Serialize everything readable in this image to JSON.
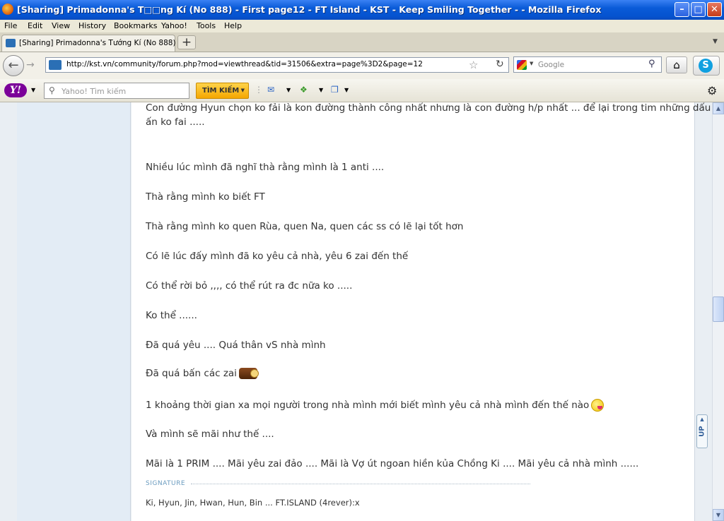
{
  "window": {
    "title": "[Sharing] Primadonna's T□□ng Kí (No 888) - First page12 - FT Island - KST - Keep Smiling Together - - Mozilla Firefox",
    "minimize": "–",
    "maximize": "□",
    "close": "✕"
  },
  "menu": [
    "File",
    "Edit",
    "View",
    "History",
    "Bookmarks",
    "Yahoo!",
    "Tools",
    "Help"
  ],
  "tabs": [
    {
      "label": "[Sharing] Primadonna's Tướng Kí (No 888) - ...",
      "icon": "kst-site-icon"
    }
  ],
  "newtab_label": "+",
  "navigation": {
    "url": "http://kst.vn/community/forum.php?mod=viewthread&tid=31506&extra=page%3D2&page=12",
    "search_placeholder": "Google"
  },
  "yahoo_toolbar": {
    "search_placeholder": "Yahoo! Tìm kiếm",
    "search_button": "TÌM KIẾM",
    "logo": "Y!"
  },
  "post": {
    "lines": [
      "Con đường Hyun chọn ko fải là kon đường thành công nhất nhưng là con đường h/p nhất ... để lại trong tim những dấu",
      "ấn ko fai .....",
      "Nhiều lúc mình đã nghĩ thà rằng mình là 1 anti ....",
      "Thà rằng mình ko biết FT",
      "Thà rằng mình ko quen Rùa, quen Na, quen các ss có lẽ lại tốt hơn",
      "Có lẽ lúc đấy mình đã ko yêu cả nhà, yêu 6 zai đến thế",
      "Có thể rời bỏ ,,,, có thể rút ra đc nữa ko .....",
      "Ko thể ......",
      "Đã quá yêu .... Quá thân vS nhà mình",
      "Đã quá bấn các zai",
      "1 khoảng thời gian xa mọi người trong nhà mình mới biết mình yêu cả nhà mình đến thế nào",
      "Và mình sẽ mãi như thế ....",
      "Mãi là 1 PRIM .... Mãi yêu zai đảo .... Mãi là Vợ út ngoan hiền kủa Chồng Ki .... Mãi yêu cả nhà mình ......"
    ],
    "emoticons": [
      "pot-emoticon",
      "tongue-emoticon"
    ]
  },
  "signature": {
    "label": "SIGNATURE",
    "text": "Ki, Hyun, Jin, Hwan, Hun, Bin ... FT.ISLAND (4rever):x"
  },
  "up_button": "UP"
}
